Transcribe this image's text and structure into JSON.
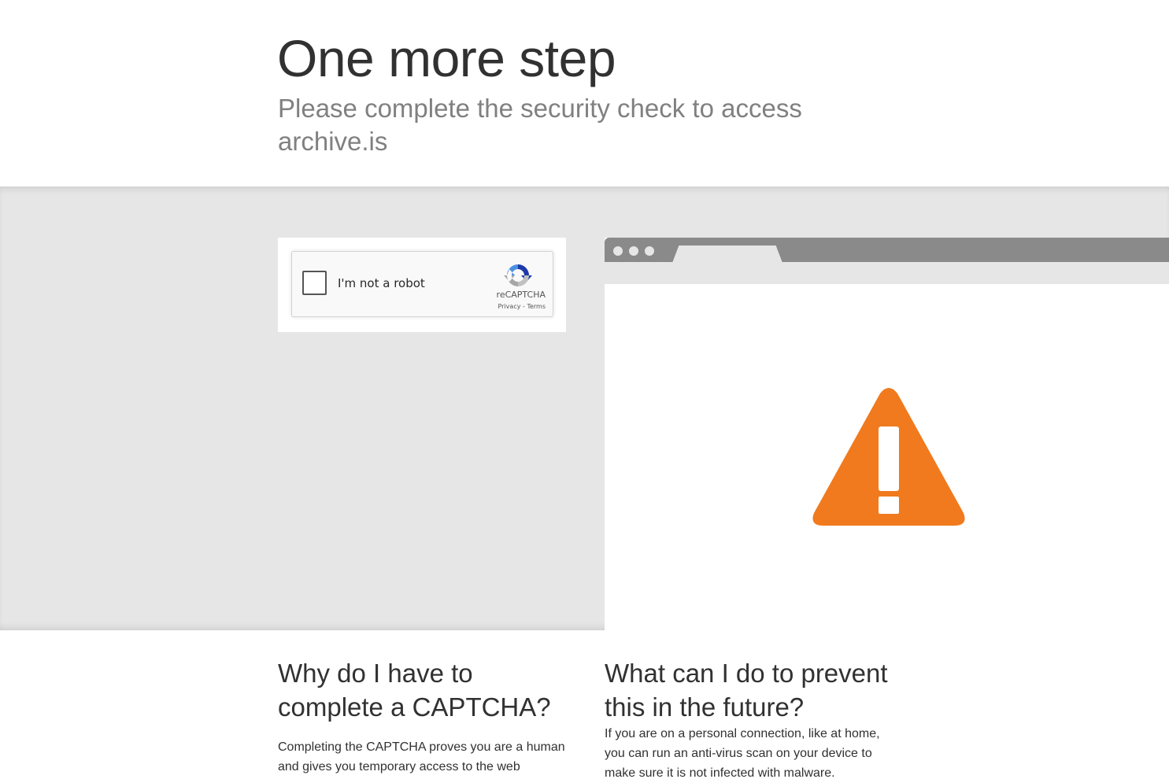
{
  "header": {
    "title": "One more step",
    "subtitle": "Please complete the security check to access archive.is"
  },
  "captcha": {
    "label": "I'm not a robot",
    "brand": "reCAPTCHA",
    "privacy_link": "Privacy",
    "separator": " - ",
    "terms_link": "Terms"
  },
  "illustration": {
    "icon": "warning-triangle-icon",
    "icon_color": "#f07a1d"
  },
  "faq": {
    "why": {
      "heading": "Why do I have to complete a CAPTCHA?",
      "body": "Completing the CAPTCHA proves you are a human and gives you temporary access to the web"
    },
    "prevent": {
      "heading": "What can I do to prevent this in the future?",
      "body": "If you are on a personal connection, like at home, you can run an anti-virus scan on your device to make sure it is not infected with malware."
    }
  },
  "colors": {
    "band_background": "#e6e6e6",
    "title_text": "#313131",
    "subtitle_text": "#808080",
    "browser_bar": "#8a8a8a",
    "recaptcha_blue": "#1c3aa9",
    "recaptcha_grey": "#a6a6a6"
  }
}
